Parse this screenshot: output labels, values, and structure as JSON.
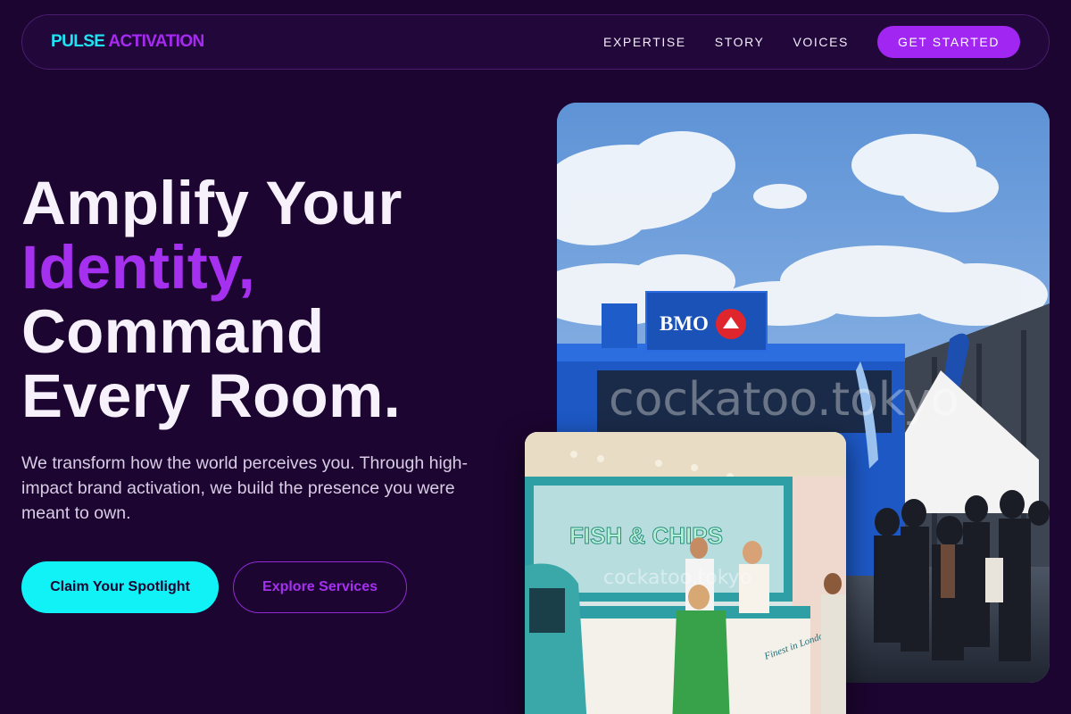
{
  "nav": {
    "logo_part1": "PULSE",
    "logo_part2": "ACTIVATION",
    "links": [
      "EXPERTISE",
      "STORY",
      "VOICES"
    ],
    "cta_label": "GET STARTED"
  },
  "hero": {
    "title_line1": "Amplify Your",
    "title_accent": "Identity,",
    "title_line3": "Command",
    "title_line4": "Every Room.",
    "subtitle": "We transform how the world perceives you. Through high-impact brand activation, we build the presence you were meant to own.",
    "primary_button": "Claim Your Spotlight",
    "secondary_button": "Explore Services"
  },
  "images": {
    "main_sign_text": "BMO",
    "main_watermark": "cockatoo.tokyo",
    "second_sign_text": "FISH & CHIPS",
    "second_watermark": "cockatoo.tokyo",
    "second_counter_text": "Finest in London!"
  },
  "colors": {
    "background": "#1c0530",
    "accent_purple": "#a630f0",
    "accent_cyan": "#10f2f6"
  }
}
